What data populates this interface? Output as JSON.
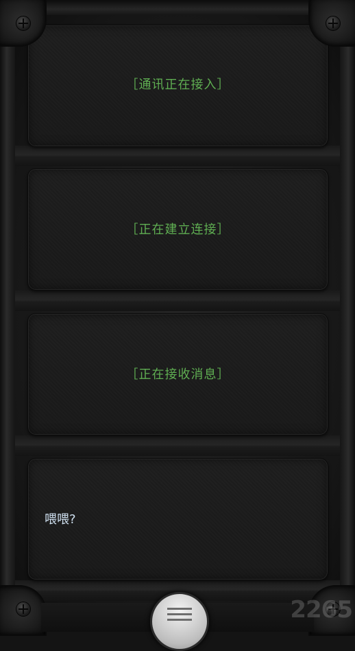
{
  "messages": [
    "［通讯正在接入］",
    "［正在建立连接］",
    "［正在接收消息］"
  ],
  "dialog": {
    "line": "喂喂?"
  },
  "watermark": "2265",
  "colors": {
    "system_text": "#5fae52",
    "dialog_text": "#cfe0f0"
  },
  "icons": {
    "menu": "hamburger-menu-icon",
    "screw": "screw-icon"
  }
}
